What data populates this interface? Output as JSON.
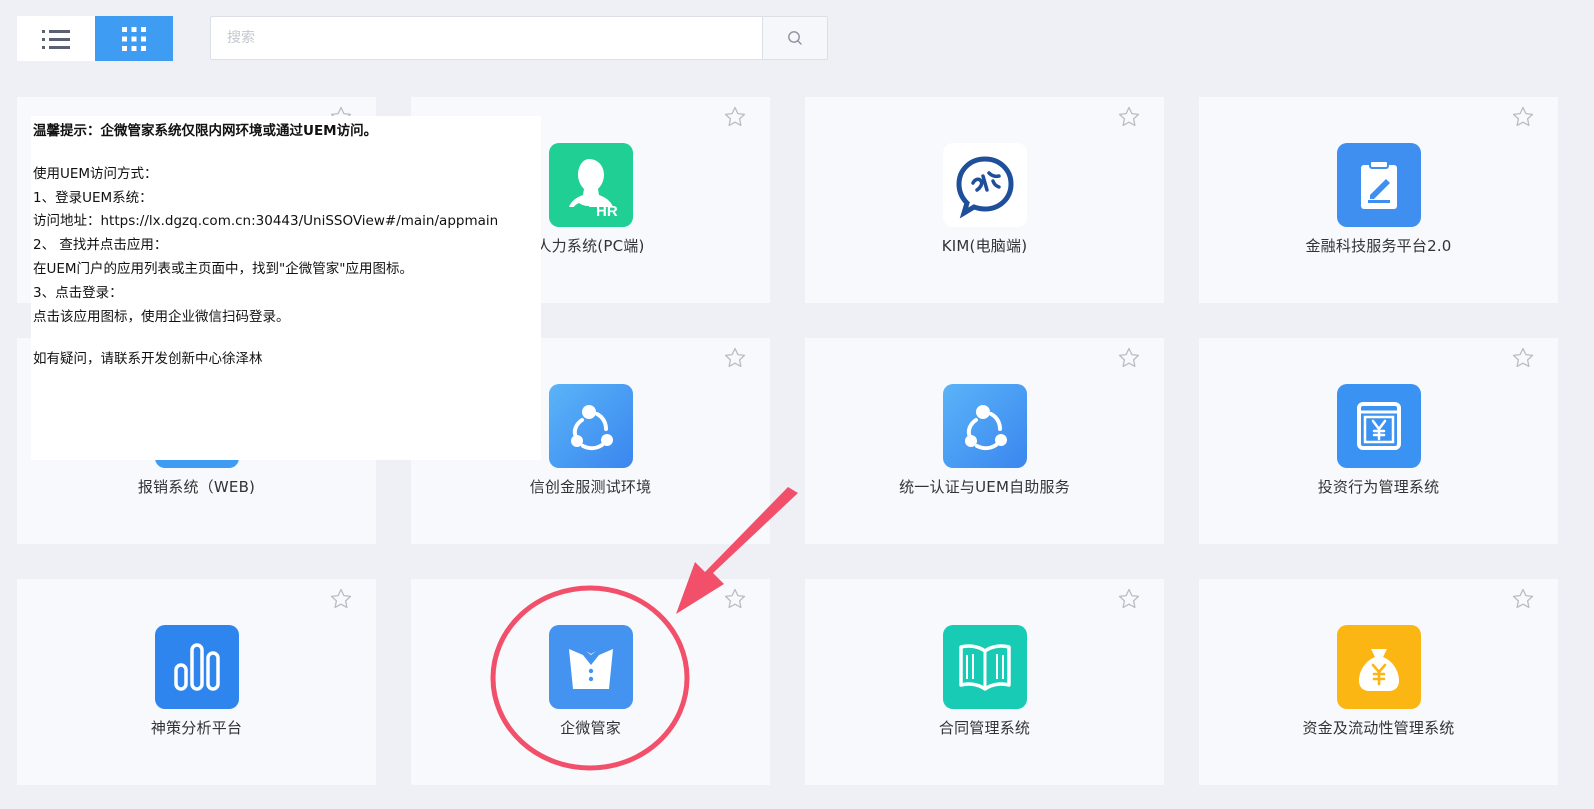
{
  "toolbar": {
    "list_view_icon": "list-icon",
    "grid_view_icon": "grid-icon",
    "active_view": "grid",
    "accent": "#3e9df2"
  },
  "search": {
    "placeholder": "搜索",
    "value": "",
    "icon": "search-icon"
  },
  "apps": [
    {
      "name": "人力系统(PC端)",
      "icon": "hr-icon",
      "color": "#1fcf93"
    },
    {
      "name": "KIM(电脑端)",
      "icon": "kim-icon",
      "color": "#ffffff"
    },
    {
      "name": "金融科技服务平台2.0",
      "icon": "clipboard-pen-icon",
      "color": "#3f8ff0"
    },
    {
      "name": "报销系统（WEB)",
      "icon": "app-icon",
      "color": "#3f9cf2"
    },
    {
      "name": "信创金服测试环境",
      "icon": "share-nodes-icon",
      "color": "#4aa4f5"
    },
    {
      "name": "统一认证与UEM自助服务",
      "icon": "share-nodes-icon",
      "color": "#4aa4f5"
    },
    {
      "name": "投资行为管理系统",
      "icon": "yen-screen-icon",
      "color": "#3a92f3"
    },
    {
      "name": "神策分析平台",
      "icon": "bar-chart-icon",
      "color": "#2f85ee"
    },
    {
      "name": "企微管家",
      "icon": "butler-suit-icon",
      "color": "#4493f0"
    },
    {
      "name": "合同管理系统",
      "icon": "open-book-icon",
      "color": "#18cbb5"
    },
    {
      "name": "资金及流动性管理系统",
      "icon": "money-bag-icon",
      "color": "#fbb614"
    }
  ],
  "tooltip": {
    "title": "温馨提示：企微管家系统仅限内网环境或通过UEM访问。",
    "line1": "使用UEM访问方式：",
    "line2": "1、登录UEM系统：",
    "line3": "访问地址：https://lx.dgzq.com.cn:30443/UniSSOView#/main/appmain",
    "line4": "2、 查找并点击应用：",
    "line5": "在UEM门户的应用列表或主页面中，找到\"企微管家\"应用图标。",
    "line6": "3、点击登录：",
    "line7": "点击该应用图标，使用企业微信扫码登录。",
    "contact": "如有疑问，请联系开发创新中心徐泽林"
  },
  "annotation": {
    "color": "#f2506a",
    "target": "企微管家"
  }
}
